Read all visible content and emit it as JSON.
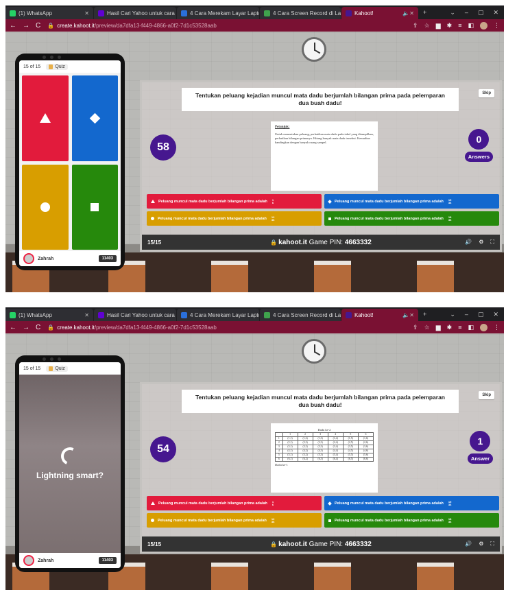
{
  "browser": {
    "tabs": [
      {
        "label": "(1) WhatsApp",
        "icon_color": "#25d366"
      },
      {
        "label": "Hasil Cari Yahoo untuk cara",
        "icon_color": "#6001d2"
      },
      {
        "label": "4 Cara Merekam Layar Lapto",
        "icon_color": "#2a6fdb"
      },
      {
        "label": "4 Cara Screen Record di Lap",
        "icon_color": "#3fa34d"
      },
      {
        "label": "Kahoot!",
        "icon_color": "#46178f"
      }
    ],
    "url_host": "create.kahoot.it",
    "url_path": "/preview/da7dfa13-f449-4866-a0f2-7d1c53528aab"
  },
  "phone": {
    "counter": "15 of 15",
    "quiz_label": "Quiz",
    "player_name": "Zahrah",
    "score": "11403",
    "lightning_text": "Lightning smart?"
  },
  "board": {
    "question": "Tentukan peluang kejadian muncul mata dadu berjumlah bilangan prima pada pelemparan dua buah dadu!",
    "skip_label": "Skip",
    "hint_title": "Petunjuk:",
    "hint_text": "Untuk menentukan peluang, perhatikan mata dadu pada tabel yang ditampilkan, perhatikan bilangan primanya. Hitung banyak mata dadu tersebut. Kemudian bandingkan dengan banyak ruang sampel.",
    "table_title": "Dadu ke-2",
    "table_side": "Dadu ke-1",
    "table_header": [
      "",
      "1",
      "2",
      "3",
      "4",
      "5",
      "6"
    ],
    "table_rows": [
      [
        "1",
        "(1,1)",
        "(1,2)",
        "(1,3)",
        "(1,4)",
        "(1,5)",
        "(1,6)"
      ],
      [
        "2",
        "(2,1)",
        "(2,2)",
        "(2,3)",
        "(2,4)",
        "(2,5)",
        "(2,6)"
      ],
      [
        "3",
        "(3,1)",
        "(3,2)",
        "(3,3)",
        "(3,4)",
        "(3,5)",
        "(3,6)"
      ],
      [
        "4",
        "(4,1)",
        "(4,2)",
        "(4,3)",
        "(4,4)",
        "(4,5)",
        "(4,6)"
      ],
      [
        "5",
        "(5,1)",
        "(5,2)",
        "(5,3)",
        "(5,4)",
        "(5,5)",
        "(5,6)"
      ],
      [
        "6",
        "(6,1)",
        "(6,2)",
        "(6,3)",
        "(6,4)",
        "(6,5)",
        "(6,6)"
      ]
    ],
    "answer_label": "Answers",
    "answer_label_single": "Answer",
    "options": [
      {
        "text": "Peluang muncul mata dadu berjumlah bilangan prima adalah",
        "num": "1",
        "den": "6",
        "color": "#e21b3c",
        "shape": "triangle"
      },
      {
        "text": "Peluang muncul mata dadu berjumlah bilangan prima adalah",
        "num": "15",
        "den": "36",
        "color": "#1368ce",
        "shape": "diamond"
      },
      {
        "text": "Peluang muncul mata dadu berjumlah bilangan prima adalah",
        "num": "12",
        "den": "36",
        "color": "#d89e00",
        "shape": "circle"
      },
      {
        "text": "Peluang muncul mata dadu berjumlah bilangan prima adalah",
        "num": "18",
        "den": "36",
        "color": "#26890c",
        "shape": "square"
      }
    ],
    "counter": "15/15",
    "brand": "kahoot.it",
    "pin_label": "Game PIN:",
    "pin": "4663332"
  },
  "frames": [
    {
      "timer": "58",
      "answers": "0"
    },
    {
      "timer": "54",
      "answers": "1"
    }
  ]
}
